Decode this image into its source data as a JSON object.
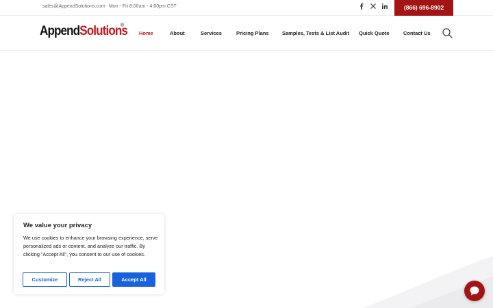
{
  "topbar": {
    "email": "sales@AppendSolutions.com",
    "hours": "Mon - Fri 8:00am - 4:00pm CST",
    "social": [
      "facebook-icon",
      "x-icon",
      "linkedin-icon"
    ],
    "phone": "(866) 696-8902"
  },
  "header": {
    "logo_part1": "Append",
    "logo_part2": "Solutions",
    "logo_reg": "®",
    "nav": [
      {
        "label": "Home",
        "active": true
      },
      {
        "label": "About"
      },
      {
        "label": "Services"
      },
      {
        "label": "Pricing Plans"
      },
      {
        "label": "Samples, Tests & List Audit"
      },
      {
        "label": "Quick Quote"
      },
      {
        "label": "Contact Us"
      }
    ]
  },
  "cookie": {
    "title": "We value your privacy",
    "text": "We use cookies to enhance your browsing experience, serve personalized ads or content, and analyze our traffic. By clicking \"Accept All\", you consent to our use of cookies.",
    "customize": "Customize",
    "reject": "Reject All",
    "accept": "Accept All"
  },
  "colors": {
    "brand_red": "#a31414",
    "accent_blue": "#1863dc"
  }
}
